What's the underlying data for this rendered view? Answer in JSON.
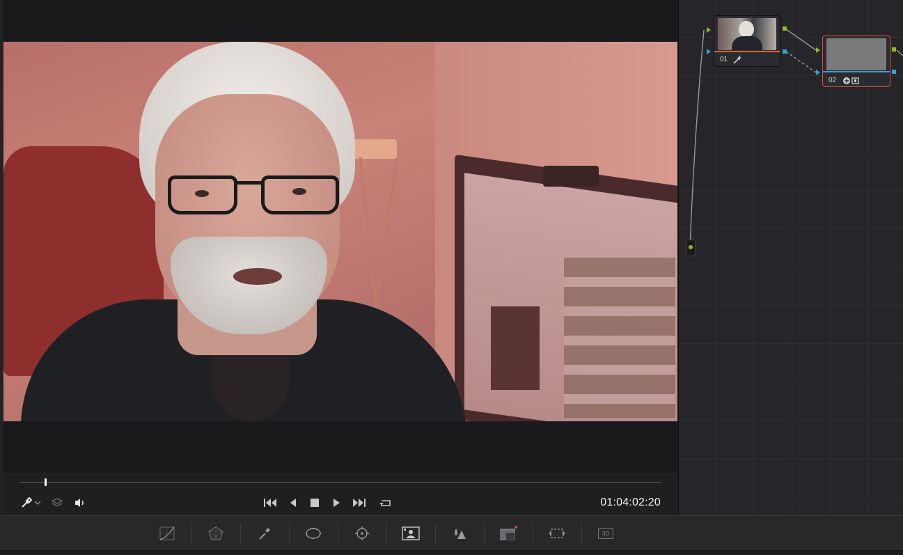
{
  "viewer": {
    "timecode": "01:04:02:20",
    "scrub_progress": 0.04
  },
  "nodes": [
    {
      "label": "01"
    },
    {
      "label": "02"
    }
  ],
  "colors": {
    "accent_orange": "#e85d2a",
    "node_selected_border": "#e2473a",
    "port_green": "#7ec41e",
    "port_blue": "#2aa6e0",
    "background": "#1e1e21"
  },
  "palette_icons": [
    "curves-icon",
    "color-warper-icon",
    "qualifier-icon",
    "window-icon",
    "tracker-icon",
    "magic-mask-icon",
    "blur-icon",
    "key-icon",
    "sizing-icon",
    "3d-icon"
  ],
  "palette_labels": {
    "three_d": "3D"
  }
}
